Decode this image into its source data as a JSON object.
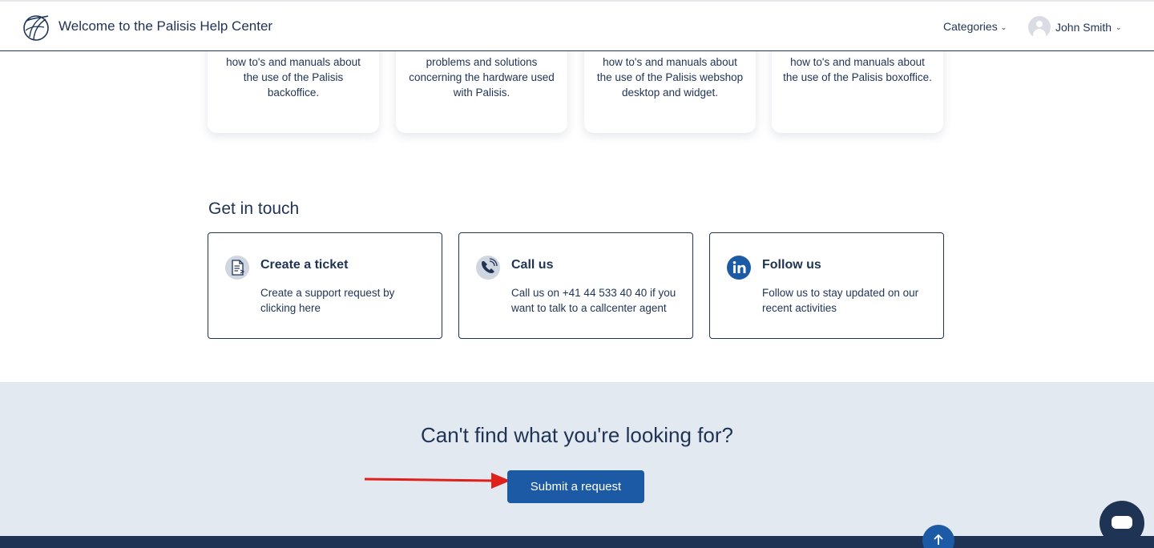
{
  "header": {
    "title": "Welcome to the Palisis Help Center",
    "categories_label": "Categories",
    "user_name": "John Smith"
  },
  "categories": [
    {
      "description": "how to's and manuals about the use of the Palisis backoffice."
    },
    {
      "description": "problems and solutions concerning the hardware used with Palisis."
    },
    {
      "description": "how to's and manuals about the use of the Palisis webshop desktop and widget."
    },
    {
      "description": "how to's and manuals about the use of the Palisis boxoffice."
    }
  ],
  "contact": {
    "title": "Get in touch",
    "cards": [
      {
        "title": "Create a ticket",
        "description": "Create a support request by clicking here",
        "icon": "document-icon"
      },
      {
        "title": "Call us",
        "description": "Call us on +41 44 533 40 40 if you want to talk to a callcenter agent",
        "icon": "phone-icon"
      },
      {
        "title": "Follow us",
        "description": "Follow us to stay updated on our recent activities",
        "icon": "linkedin-icon"
      }
    ]
  },
  "banner": {
    "title": "Can't find what you're looking for?",
    "button_label": "Submit a request"
  },
  "colors": {
    "navy": "#1f3354",
    "button_blue": "#1d5aa6",
    "banner_bg": "#e3e9f1",
    "annotation_red": "#e0201b"
  }
}
